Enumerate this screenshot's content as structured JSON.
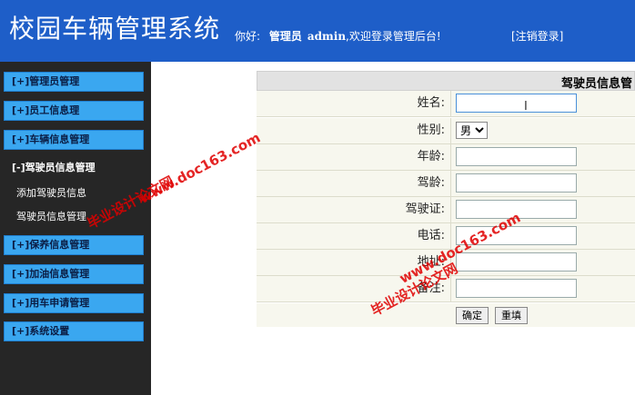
{
  "header": {
    "title": "校园车辆管理系统",
    "greeting": "你好:",
    "user_role": "管理员",
    "username": "admin",
    "welcome_message": ",欢迎登录管理后台!",
    "logout_label": "[注销登录]"
  },
  "sidebar": {
    "items": [
      {
        "label": "[+]管理员管理"
      },
      {
        "label": "[+]员工信息理"
      },
      {
        "label": "[+]车辆信息管理"
      },
      {
        "label": "[-]驾驶员信息管理"
      },
      {
        "label": "[+]保养信息管理"
      },
      {
        "label": "[+]加油信息管理"
      },
      {
        "label": "[+]用车申请管理"
      },
      {
        "label": "[+]系统设置"
      }
    ],
    "sub_items": [
      {
        "label": "添加驾驶员信息"
      },
      {
        "label": "驾驶员信息管理"
      }
    ]
  },
  "form": {
    "title": "驾驶员信息管",
    "fields": {
      "name": {
        "label": "姓名:",
        "value": ""
      },
      "gender": {
        "label": "性别:",
        "value": "男"
      },
      "age": {
        "label": "年龄:",
        "value": ""
      },
      "driving_years": {
        "label": "驾龄:",
        "value": ""
      },
      "license": {
        "label": "驾驶证:",
        "value": ""
      },
      "phone": {
        "label": "电话:",
        "value": ""
      },
      "address": {
        "label": "地址:",
        "value": ""
      },
      "remark": {
        "label": "备注:",
        "value": ""
      }
    },
    "submit_label": "确定",
    "reset_label": "重填"
  },
  "watermarks": {
    "url": "www.doc163.com",
    "site": "毕业设计论文网"
  },
  "colors": {
    "header_bg": "#1e5ec8",
    "sidebar_bg": "#262626",
    "menu_item_bg": "#3aa7f0",
    "watermark": "#e00000"
  }
}
